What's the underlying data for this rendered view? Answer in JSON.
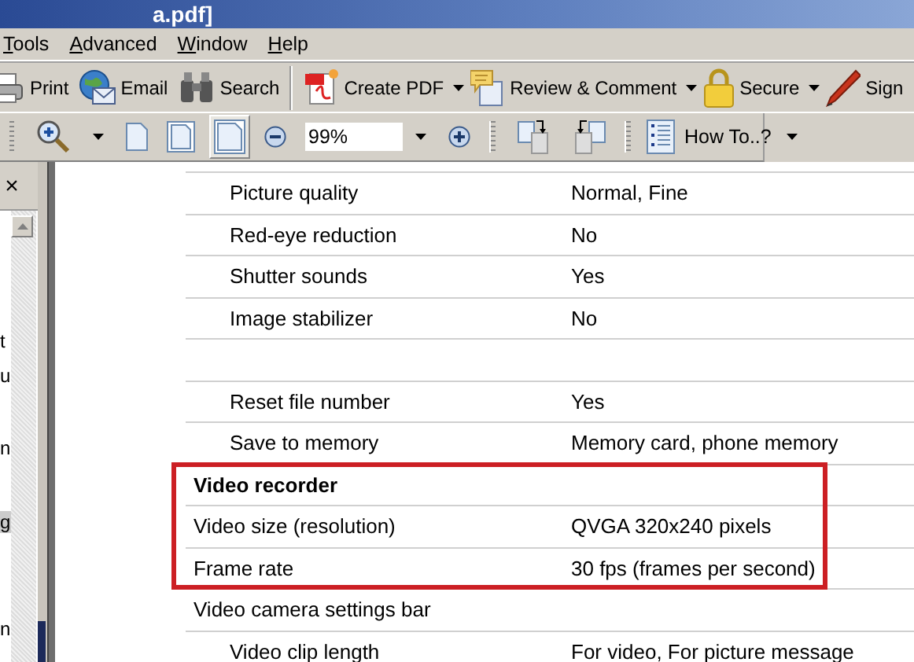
{
  "window": {
    "title": "a.pdf]"
  },
  "menu": [
    {
      "label": "Tools"
    },
    {
      "label": "Advanced"
    },
    {
      "label": "Window"
    },
    {
      "label": "Help"
    }
  ],
  "toolbar_1": [
    {
      "kind": "button",
      "label": "Print"
    },
    {
      "kind": "button",
      "label": "Email"
    },
    {
      "kind": "button",
      "label": "Search"
    },
    {
      "kind": "sep"
    },
    {
      "kind": "menubutton",
      "label": "Create PDF"
    },
    {
      "kind": "menubutton",
      "label": "Review & Comment"
    },
    {
      "kind": "menubutton",
      "label": "Secure"
    },
    {
      "kind": "button",
      "label": "Sign"
    }
  ],
  "toolbar_2": [
    {
      "kind": "grip"
    },
    {
      "kind": "menutool",
      "selected": false
    },
    {
      "kind": "tool",
      "selected": false
    },
    {
      "kind": "tool",
      "selected": false
    },
    {
      "kind": "tool",
      "selected": true
    },
    {
      "kind": "tool",
      "selected": false
    },
    {
      "kind": "field",
      "value": "99%"
    },
    {
      "kind": "tool",
      "selected": false
    },
    {
      "kind": "grip"
    },
    {
      "kind": "tool",
      "selected": false
    },
    {
      "kind": "tool",
      "selected": false
    },
    {
      "kind": "grip"
    },
    {
      "kind": "button",
      "label": "How To..?"
    }
  ],
  "nav_panel": {
    "close": "×",
    "bookmarks": [
      {
        "label": "t",
        "selected": false
      },
      {
        "label": "u",
        "selected": false
      },
      {
        "label": "n",
        "selected": false
      },
      {
        "label": "g",
        "selected": true
      },
      {
        "label": "n",
        "selected": false
      }
    ]
  },
  "document": {
    "rows": [
      {
        "kind": "item",
        "label": "Picture quality",
        "value": "Normal, Fine",
        "highlighted": false
      },
      {
        "kind": "item",
        "label": "Red-eye reduction",
        "value": "No",
        "highlighted": false
      },
      {
        "kind": "item",
        "label": "Shutter sounds",
        "value": "Yes",
        "highlighted": false
      },
      {
        "kind": "item",
        "label": "Image stabilizer",
        "value": "No",
        "highlighted": false
      },
      {
        "kind": "blank",
        "highlighted": false
      },
      {
        "kind": "item",
        "label": "Reset file number",
        "value": "Yes",
        "highlighted": false
      },
      {
        "kind": "item",
        "label": "Save to memory",
        "value": "Memory card, phone memory",
        "highlighted": false
      },
      {
        "kind": "heading",
        "label": "Video recorder",
        "highlighted": true
      },
      {
        "kind": "plain",
        "label": "Video size (resolution)",
        "value": "QVGA 320x240 pixels",
        "highlighted": true
      },
      {
        "kind": "plain",
        "label": "Frame rate",
        "value": "30 fps (frames per second)",
        "highlighted": true
      },
      {
        "kind": "plain",
        "label": "Video camera settings bar",
        "highlighted": false
      },
      {
        "kind": "item",
        "label": "Video clip length",
        "value": "For video, For picture message",
        "highlighted": false
      }
    ]
  }
}
